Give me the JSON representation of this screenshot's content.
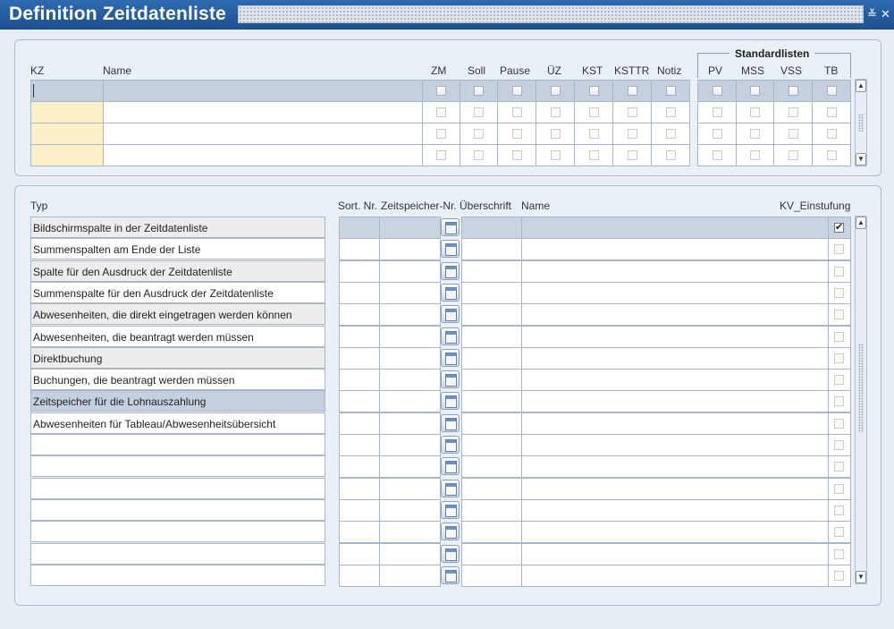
{
  "window": {
    "title": "Definition Zeitdatenliste",
    "minimize_glyph": "≚",
    "close_glyph": "✕"
  },
  "top": {
    "headers": {
      "kz": "KZ",
      "name": "Name",
      "zm": "ZM",
      "soll": "Soll",
      "pause": "Pause",
      "uz": "ÜZ",
      "kst": "KST",
      "ksttr": "KSTTR",
      "notiz": "Notiz",
      "std_group": "Standardlisten",
      "pv": "PV",
      "mss": "MSS",
      "vss": "VSS",
      "tb": "TB"
    },
    "rows": [
      {
        "kz": "",
        "name": ""
      },
      {
        "kz": "",
        "name": ""
      },
      {
        "kz": "",
        "name": ""
      },
      {
        "kz": "",
        "name": ""
      }
    ]
  },
  "bottom": {
    "headers": {
      "typ": "Typ",
      "sort_nr": "Sort. Nr.",
      "zeitspeicher_nr": "Zeitspeicher-Nr.",
      "ueberschrift": "Überschrift",
      "name": "Name",
      "kv": "KV_Einstufung"
    },
    "types": [
      "Bildschirmspalte in der Zeitdatenliste",
      "Summenspalten am Ende der Liste",
      "Spalte für den Ausdruck der Zeitdatenliste",
      "Summenspalte für den Ausdruck der Zeitdatenliste",
      "Abwesenheiten, die direkt eingetragen werden können",
      "Abwesenheiten, die beantragt werden müssen",
      "Direktbuchung",
      "Buchungen, die beantragt werden müssen",
      "Zeitspeicher für die Lohnauszahlung",
      "Abwesenheiten für Tableau/Abwesenheitsübersicht",
      "",
      "",
      "",
      "",
      "",
      "",
      ""
    ],
    "kv_checked_row": 0,
    "selected_type_row": 8
  },
  "icons": {
    "calendar": "calendar-icon",
    "scroll_up": "scroll-up-icon",
    "scroll_down": "scroll-down-icon"
  }
}
